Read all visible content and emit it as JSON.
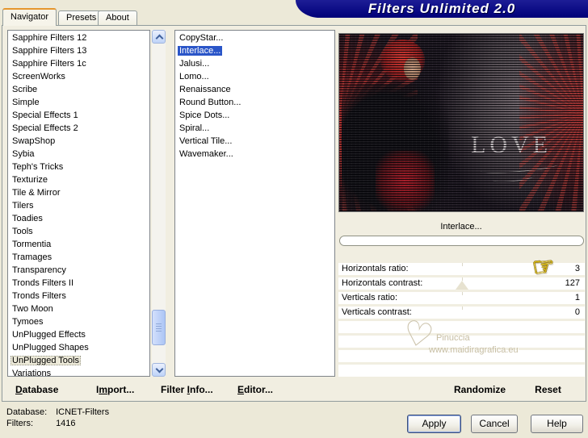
{
  "window": {
    "title": "Filters Unlimited 2.0"
  },
  "tabs": [
    {
      "label": "Navigator",
      "active": true
    },
    {
      "label": "Presets",
      "active": false
    },
    {
      "label": "About",
      "active": false
    }
  ],
  "category_list": {
    "selected": "UnPlugged Tools",
    "items": [
      "Sapphire Filters 12",
      "Sapphire Filters 13",
      "Sapphire Filters 1c",
      "ScreenWorks",
      "Scribe",
      "Simple",
      "Special Effects 1",
      "Special Effects 2",
      "SwapShop",
      "Sybia",
      "Teph's Tricks",
      "Texturize",
      "Tile & Mirror",
      "Tilers",
      "Toadies",
      "Tools",
      "Tormentia",
      "Tramages",
      "Transparency",
      "Tronds Filters II",
      "Tronds Filters",
      "Two Moon",
      "Tymoes",
      "UnPlugged Effects",
      "UnPlugged Shapes",
      "UnPlugged Tools",
      "Variations"
    ]
  },
  "filter_list": {
    "selected": "Interlace...",
    "items": [
      "CopyStar...",
      "Interlace...",
      "Jalusi...",
      "Lomo...",
      "Renaissance",
      "Round Button...",
      "Spice Dots...",
      "Spiral...",
      "Vertical Tile...",
      "Wavemaker..."
    ]
  },
  "preview": {
    "caption": "Interlace...",
    "image_text": "LOVE"
  },
  "params": [
    {
      "label": "Horizontals ratio:",
      "value": "3",
      "thumb": ""
    },
    {
      "label": "Horizontals contrast:",
      "value": "127",
      "thumb": "center"
    },
    {
      "label": "Verticals ratio:",
      "value": "1",
      "thumb": ""
    },
    {
      "label": "Verticals contrast:",
      "value": "0",
      "thumb": ""
    }
  ],
  "watermark": {
    "heart": "♡",
    "line1": "Pinuccia",
    "line2": "www.maidiragrafica.eu"
  },
  "toolbar": {
    "database": {
      "pre": "",
      "key": "D",
      "post": "atabase"
    },
    "import": {
      "pre": "I",
      "key": "m",
      "post": "port..."
    },
    "filterinfo": {
      "pre": "Filter ",
      "key": "I",
      "post": "nfo..."
    },
    "editor": {
      "pre": "",
      "key": "E",
      "post": "ditor..."
    }
  },
  "actions": {
    "randomize": "Randomize",
    "reset": "Reset"
  },
  "status": {
    "database_label": "Database:",
    "database_value": "ICNET-Filters",
    "filters_label": "Filters:",
    "filters_value": "1416"
  },
  "buttons": {
    "apply": "Apply",
    "cancel": "Cancel",
    "help": "Help"
  },
  "icons": {
    "pointing_hand": "☞"
  },
  "colors": {
    "title_navy": "#000078",
    "selection_blue": "#2A55C8",
    "window_beige": "#ECE9D8",
    "tab_accent_orange": "#E5962D",
    "hand_yellow": "#F6D60C"
  }
}
